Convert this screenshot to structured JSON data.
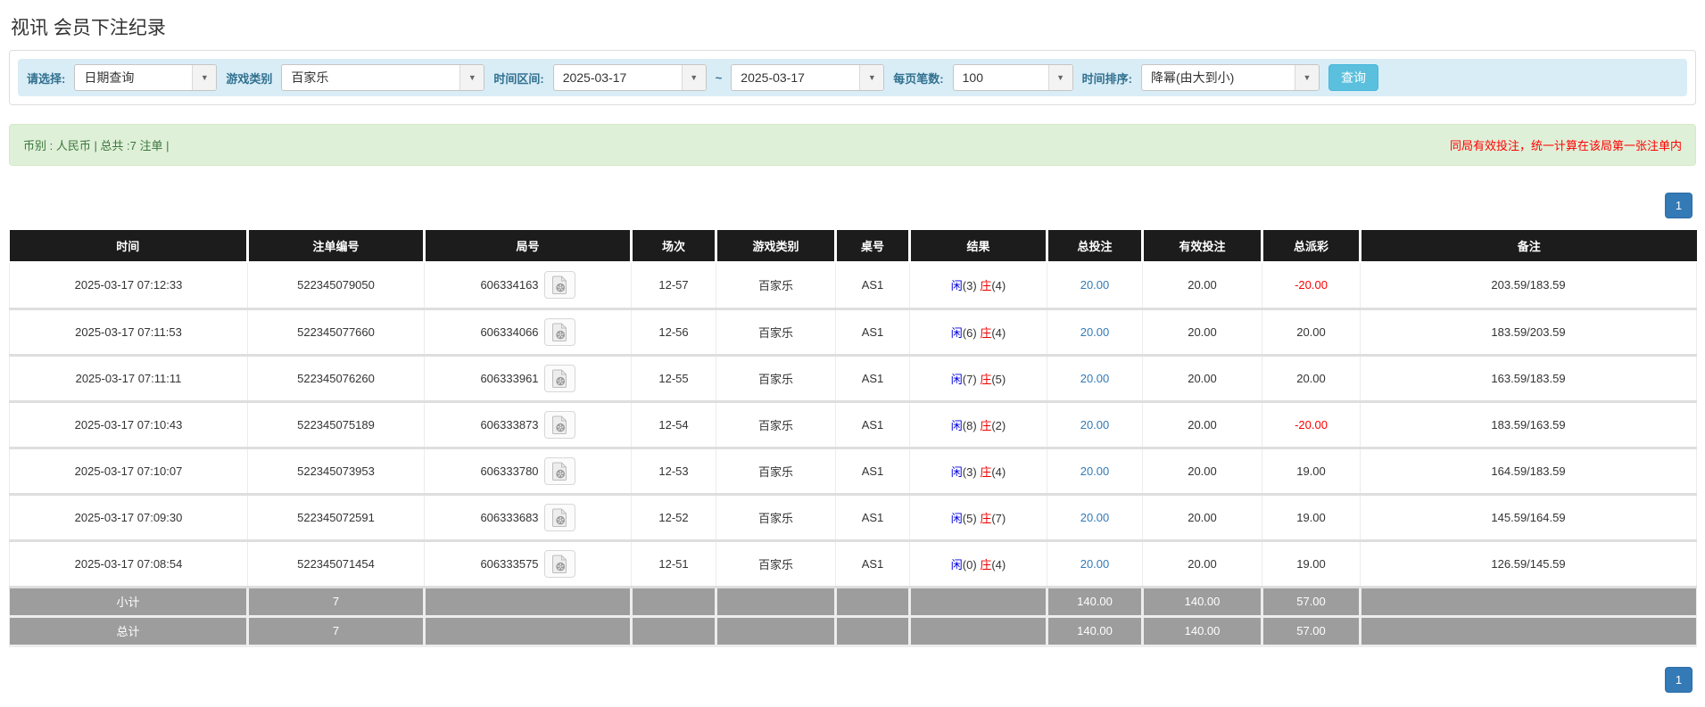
{
  "page": {
    "title": "视讯 会员下注纪录"
  },
  "filters": {
    "select_label": "请选择:",
    "select_value": "日期查询",
    "game_label": "游戏类别",
    "game_value": "百家乐",
    "range_label": "时间区间:",
    "date_from": "2025-03-17",
    "range_separator": "~",
    "date_to": "2025-03-17",
    "per_page_label": "每页笔数:",
    "per_page_value": "100",
    "sort_label": "时间排序:",
    "sort_value": "降幂(由大到小)",
    "search_button": "查询",
    "dropdown_arrow_icon": "chevron-down-icon"
  },
  "info_bar": {
    "summary": "币别 : 人民币 | 总共 :7 注单 |",
    "notice": "同局有效投注，统一计算在该局第一张注单内"
  },
  "pagination": {
    "page": "1"
  },
  "icons": {
    "round_video": "video-file-icon"
  },
  "colors": {
    "accent_blue": "#337ab7",
    "search_button": "#5bc0de",
    "filter_bg": "#d9edf7",
    "info_bg": "#dff0d8",
    "info_text": "#3c763d",
    "notice_red": "#ff0000",
    "header_bg": "#1c1c1c",
    "footer_bg": "#9d9d9d",
    "player_blue": "#0000dd",
    "banker_red": "#ee0000"
  },
  "table": {
    "headers": [
      "时间",
      "注单编号",
      "局号",
      "场次",
      "游戏类别",
      "桌号",
      "结果",
      "总投注",
      "有效投注",
      "总派彩",
      "备注"
    ],
    "rows": [
      {
        "time": "2025-03-17 07:12:33",
        "bet_no": "522345079050",
        "round_no": "606334163",
        "session": "12-57",
        "game": "百家乐",
        "table_no": "AS1",
        "player": "闲",
        "player_count": "(3)",
        "banker": "庄",
        "banker_count": "(4)",
        "total_bet": "20.00",
        "valid_bet": "20.00",
        "payout": "-20.00",
        "remark": "203.59/183.59"
      },
      {
        "time": "2025-03-17 07:11:53",
        "bet_no": "522345077660",
        "round_no": "606334066",
        "session": "12-56",
        "game": "百家乐",
        "table_no": "AS1",
        "player": "闲",
        "player_count": "(6)",
        "banker": "庄",
        "banker_count": "(4)",
        "total_bet": "20.00",
        "valid_bet": "20.00",
        "payout": "20.00",
        "remark": "183.59/203.59"
      },
      {
        "time": "2025-03-17 07:11:11",
        "bet_no": "522345076260",
        "round_no": "606333961",
        "session": "12-55",
        "game": "百家乐",
        "table_no": "AS1",
        "player": "闲",
        "player_count": "(7)",
        "banker": "庄",
        "banker_count": "(5)",
        "total_bet": "20.00",
        "valid_bet": "20.00",
        "payout": "20.00",
        "remark": "163.59/183.59"
      },
      {
        "time": "2025-03-17 07:10:43",
        "bet_no": "522345075189",
        "round_no": "606333873",
        "session": "12-54",
        "game": "百家乐",
        "table_no": "AS1",
        "player": "闲",
        "player_count": "(8)",
        "banker": "庄",
        "banker_count": "(2)",
        "total_bet": "20.00",
        "valid_bet": "20.00",
        "payout": "-20.00",
        "remark": "183.59/163.59"
      },
      {
        "time": "2025-03-17 07:10:07",
        "bet_no": "522345073953",
        "round_no": "606333780",
        "session": "12-53",
        "game": "百家乐",
        "table_no": "AS1",
        "player": "闲",
        "player_count": "(3)",
        "banker": "庄",
        "banker_count": "(4)",
        "total_bet": "20.00",
        "valid_bet": "20.00",
        "payout": "19.00",
        "remark": "164.59/183.59"
      },
      {
        "time": "2025-03-17 07:09:30",
        "bet_no": "522345072591",
        "round_no": "606333683",
        "session": "12-52",
        "game": "百家乐",
        "table_no": "AS1",
        "player": "闲",
        "player_count": "(5)",
        "banker": "庄",
        "banker_count": "(7)",
        "total_bet": "20.00",
        "valid_bet": "20.00",
        "payout": "19.00",
        "remark": "145.59/164.59"
      },
      {
        "time": "2025-03-17 07:08:54",
        "bet_no": "522345071454",
        "round_no": "606333575",
        "session": "12-51",
        "game": "百家乐",
        "table_no": "AS1",
        "player": "闲",
        "player_count": "(0)",
        "banker": "庄",
        "banker_count": "(4)",
        "total_bet": "20.00",
        "valid_bet": "20.00",
        "payout": "19.00",
        "remark": "126.59/145.59"
      }
    ],
    "footer": [
      {
        "label": "小计",
        "count": "7",
        "total_bet": "140.00",
        "valid_bet": "140.00",
        "payout": "57.00"
      },
      {
        "label": "总计",
        "count": "7",
        "total_bet": "140.00",
        "valid_bet": "140.00",
        "payout": "57.00"
      }
    ]
  }
}
